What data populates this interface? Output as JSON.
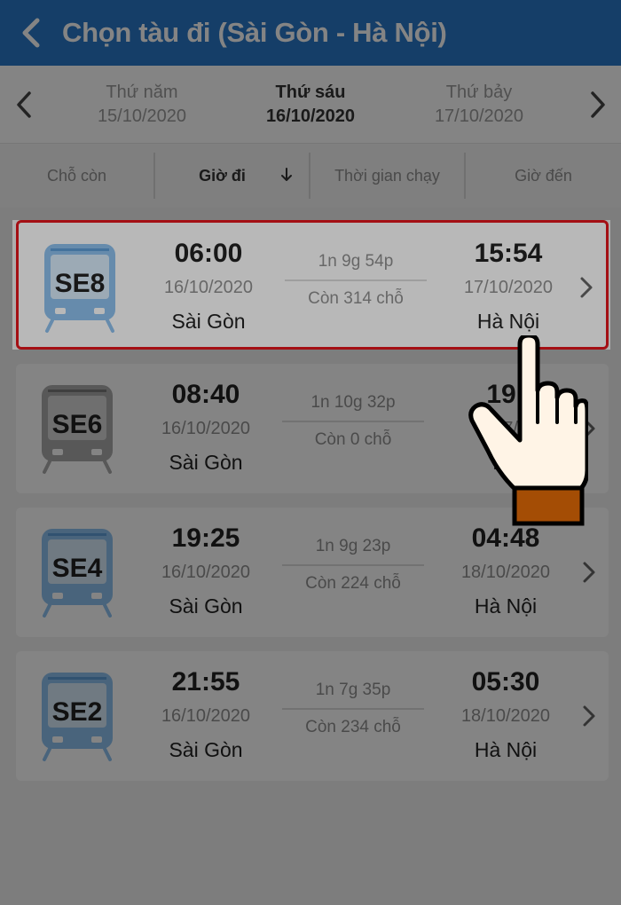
{
  "header": {
    "title": "Chọn tàu đi (Sài Gòn - Hà Nội)",
    "back_icon": "chevron-left-icon",
    "bg_color": "#2a78c8"
  },
  "datebar": {
    "prev": {
      "day": "Thứ năm",
      "date": "15/10/2020"
    },
    "current": {
      "day": "Thứ sáu",
      "date": "16/10/2020"
    },
    "next": {
      "day": "Thứ bảy",
      "date": "17/10/2020"
    }
  },
  "sort": {
    "seats_left": "Chỗ còn",
    "departure": "Giờ đi",
    "duration": "Thời gian chạy",
    "arrival": "Giờ đến",
    "active_icon": "arrow-down-icon"
  },
  "trains": [
    {
      "code": "SE8",
      "dep_time": "06:00",
      "dep_date": "16/10/2020",
      "dep_place": "Sài Gòn",
      "duration": "1n 9g 54p",
      "seats": "Còn 314 chỗ",
      "arr_time": "15:54",
      "arr_date": "17/10/2020",
      "arr_place": "Hà Nội",
      "status": "available",
      "selected": true
    },
    {
      "code": "SE6",
      "dep_time": "08:40",
      "dep_date": "16/10/2020",
      "dep_place": "Sài Gòn",
      "duration": "1n 10g 32p",
      "seats": "Còn 0 chỗ",
      "arr_time": "19:",
      "arr_date": "17/",
      "arr_place": "Hà",
      "status": "full",
      "selected": false
    },
    {
      "code": "SE4",
      "dep_time": "19:25",
      "dep_date": "16/10/2020",
      "dep_place": "Sài Gòn",
      "duration": "1n 9g 23p",
      "seats": "Còn 224 chỗ",
      "arr_time": "04:48",
      "arr_date": "18/10/2020",
      "arr_place": "Hà Nội",
      "status": "available",
      "selected": false
    },
    {
      "code": "SE2",
      "dep_time": "21:55",
      "dep_date": "16/10/2020",
      "dep_place": "Sài Gòn",
      "duration": "1n 7g 35p",
      "seats": "Còn 234 chỗ",
      "arr_time": "05:30",
      "arr_date": "18/10/2020",
      "arr_place": "Hà Nội",
      "status": "available",
      "selected": false
    }
  ],
  "colors": {
    "selected_border": "#e3161c",
    "train_available": "#8ec1ef",
    "train_full": "#a9a9a9"
  },
  "icons": {
    "train": "train-icon",
    "chevron": "chevron-right-icon",
    "pointer": "pointing-hand-icon"
  }
}
